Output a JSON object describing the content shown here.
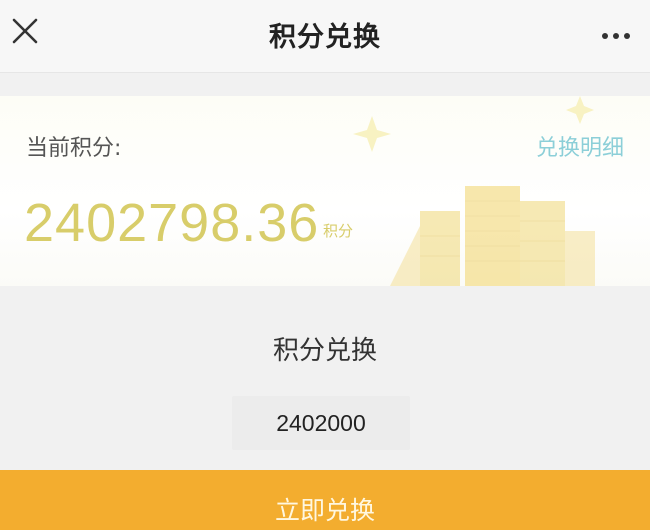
{
  "header": {
    "title": "积分兑换",
    "close_icon": "close-icon",
    "more_icon": "more-dots-icon"
  },
  "points_card": {
    "current_label": "当前积分:",
    "detail_link": "兑换明细",
    "value": "2402798.36",
    "unit": "积分"
  },
  "exchange": {
    "section_title": "积分兑换",
    "amount_value": "2402000",
    "redeem_label": "立即兑换"
  },
  "colors": {
    "accent_orange": "#f3ad2f",
    "points_gold": "#d8cd6a",
    "link_teal": "#8ccfd8"
  }
}
